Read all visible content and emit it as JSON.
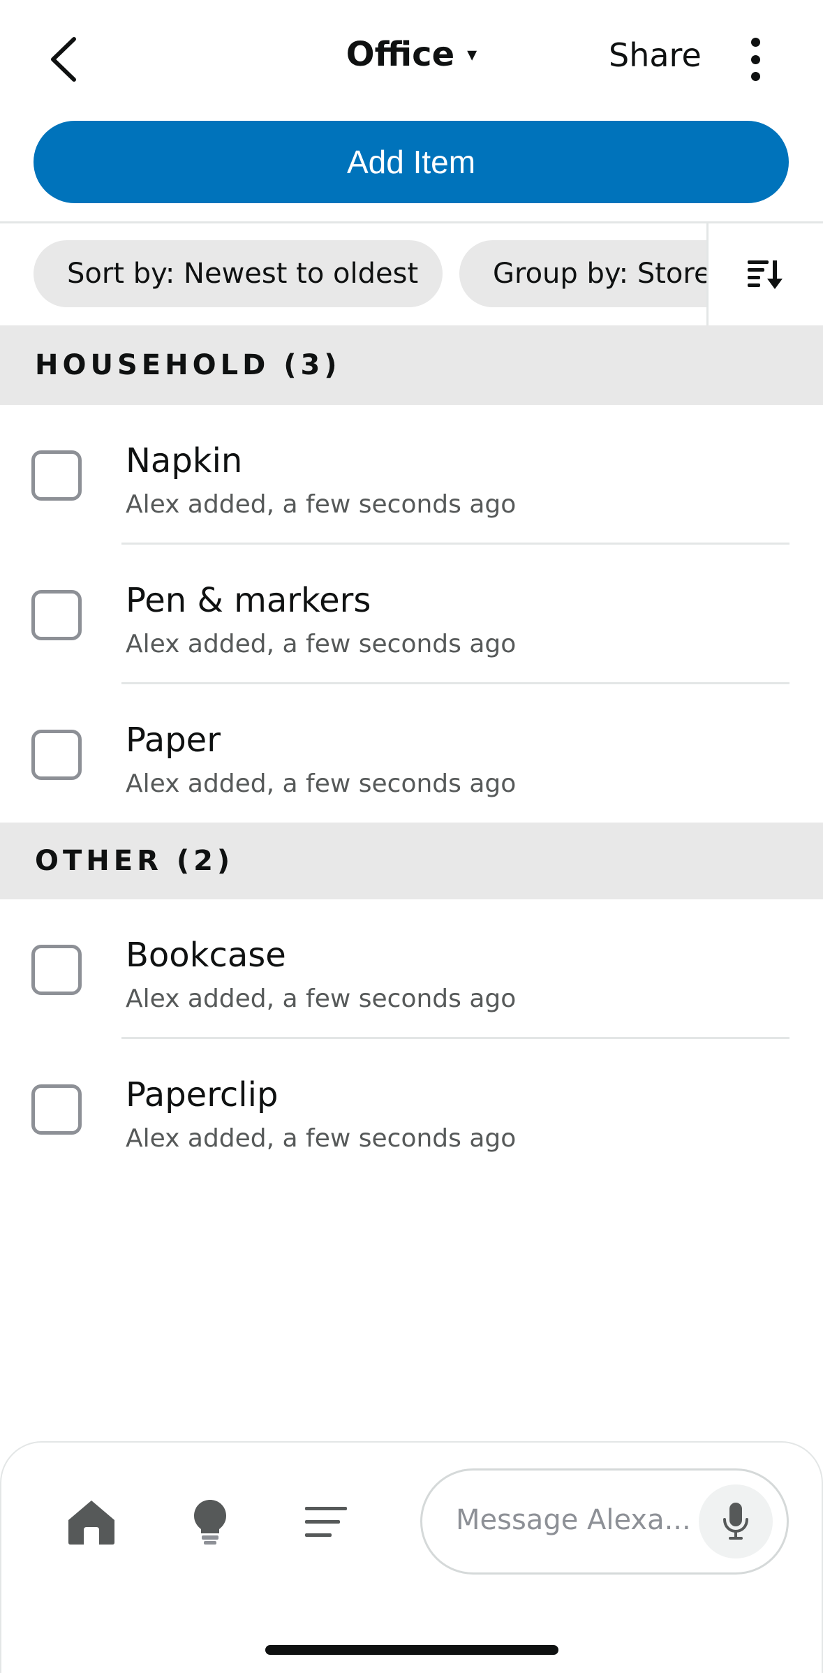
{
  "header": {
    "title": "Office",
    "title_caret": "▾",
    "share_label": "Share"
  },
  "add_item_label": "Add Item",
  "filters": {
    "sort_label": "Sort by: Newest to oldest",
    "group_label": "Group by: Store"
  },
  "sections": [
    {
      "title": "HOUSEHOLD (3)",
      "items": [
        {
          "name": "Napkin",
          "meta": "Alex added, a few seconds ago"
        },
        {
          "name": "Pen & markers",
          "meta": "Alex added, a few seconds ago"
        },
        {
          "name": "Paper",
          "meta": "Alex added, a few seconds ago"
        }
      ]
    },
    {
      "title": "OTHER (2)",
      "items": [
        {
          "name": "Bookcase",
          "meta": "Alex added, a few seconds ago"
        },
        {
          "name": "Paperclip",
          "meta": "Alex added, a few seconds ago"
        }
      ]
    }
  ],
  "bottom_nav": {
    "message_placeholder": "Message Alexa..."
  },
  "icons": [
    "back-arrow-icon",
    "more-vertical-icon",
    "sort-icon",
    "home-icon",
    "lightbulb-icon",
    "list-icon",
    "microphone-icon"
  ]
}
